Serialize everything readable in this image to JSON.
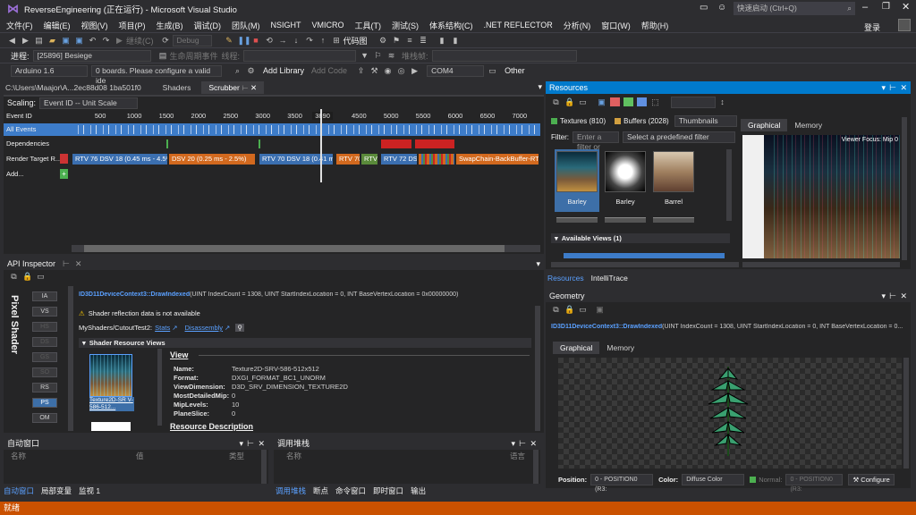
{
  "title": "ReverseEngineering (正在运行) - Microsoft Visual Studio",
  "quick_launch": "快速启动 (Ctrl+Q)",
  "menu": [
    "文件(F)",
    "编辑(E)",
    "视图(V)",
    "项目(P)",
    "生成(B)",
    "调试(D)",
    "团队(M)",
    "NSIGHT",
    "VMICRO",
    "工具(T)",
    "测试(S)",
    "体系结构(C)",
    ".NET REFLECTOR",
    "分析(N)",
    "窗口(W)",
    "帮助(H)"
  ],
  "login": "登录",
  "toolbar1": {
    "continue": "继续(C)",
    "config": "Debug",
    "codemap": "代码图"
  },
  "toolbar2": {
    "process_label": "进程:",
    "process": "[25896] Besiege",
    "lifecycle": "生命周期事件",
    "thread_label": "线程:",
    "stack_label": "堆栈帧:"
  },
  "toolbar3": {
    "board": "Arduino 1.6",
    "boards_msg": "0 boards. Please configure a valid ide",
    "add_library": "Add Library",
    "add_code": "Add Code",
    "port": "COM4",
    "other": "Other"
  },
  "scrubber": {
    "tabs": [
      "C:\\Users\\Maajor\\A...2ec88d08 1ba501f0",
      "Shaders",
      "Scrubber"
    ],
    "scaling_label": "Scaling:",
    "scaling": "Event ID -- Unit Scale",
    "event_id_label": "Event ID",
    "ticks": [
      "500",
      "1000",
      "1500",
      "2000",
      "2500",
      "3000",
      "3500",
      "3890",
      "4500",
      "5000",
      "5500",
      "6000",
      "6500",
      "7000"
    ],
    "rows": [
      "All Events",
      "Dependencies",
      "Render Target R...",
      "Add..."
    ],
    "segments": [
      "RTV 76 DSV 18 (0.45 ms - 4.5%",
      "DSV 20 (0.25 ms - 2.5%)",
      "RTV 70 DSV 18 (0.41 ms",
      "RTV 70",
      "RTV",
      "RTV 72 DS",
      "SwapChain-BackBuffer-RTV"
    ]
  },
  "api_inspector": {
    "title": "API Inspector",
    "vertical_label": "Pixel Shader",
    "stages": [
      "IA",
      "VS",
      "HS",
      "DS",
      "GS",
      "SO",
      "RS",
      "PS",
      "OM"
    ],
    "call": "ID3D11DeviceContext3::DrawIndexed",
    "call_args": "(UINT IndexCount = 1308, UINT StartIndexLocation = 0, INT BaseVertexLocation = 0x00000000)",
    "warning": "Shader reflection data is not available",
    "shader_path": "MyShaders/CutoutTest2:",
    "stats_link": "Stats",
    "disasm_link": "Disassembly",
    "section": "Shader Resource Views",
    "texture_caption": "Texture2D-SR V-586-512...",
    "view_heading": "View",
    "props": [
      {
        "k": "Name:",
        "v": "Texture2D-SRV-586-512x512"
      },
      {
        "k": "Format:",
        "v": "DXGI_FORMAT_BC1_UNORM"
      },
      {
        "k": "ViewDimension:",
        "v": "D3D_SRV_DIMENSION_TEXTURE2D"
      },
      {
        "k": "MostDetailedMip:",
        "v": "0"
      },
      {
        "k": "MipLevels:",
        "v": "10"
      },
      {
        "k": "PlaneSlice:",
        "v": "0"
      }
    ],
    "resource_desc": "Resource Description"
  },
  "autos": {
    "title": "自动窗口",
    "col_name": "名称",
    "col_value": "值",
    "col_type": "类型",
    "tabs": [
      "自动窗口",
      "局部变量",
      "监视 1"
    ]
  },
  "callstack": {
    "title": "调用堆栈",
    "col_name": "名称",
    "col_lang": "语言",
    "tabs": [
      "调用堆栈",
      "断点",
      "命令窗口",
      "即时窗口",
      "输出"
    ]
  },
  "resources": {
    "title": "Resources",
    "textures": "Textures (810)",
    "buffers": "Buffers (2028)",
    "view_mode": "Thumbnails",
    "filter_label": "Filter:",
    "filter_placeholder": "Enter a filter or",
    "predefined": "Select a predefined filter",
    "thumbs": [
      "Barley",
      "Barley",
      "Barrel"
    ],
    "available_views": "Available Views (1)",
    "tabs": [
      "Graphical",
      "Memory"
    ],
    "viewer_focus": "Viewer Focus: Mip 0",
    "bottom_tabs": [
      "Resources",
      "IntelliTrace"
    ]
  },
  "geometry": {
    "title": "Geometry",
    "call": "ID3D11DeviceContext3::DrawIndexed",
    "call_args": "(UINT IndexCount = 1308, UINT StartIndexLocation = 0, INT BaseVertexLocation = 0...",
    "tabs": [
      "Graphical",
      "Memory"
    ],
    "position_label": "Position:",
    "position": "0 - POSITION0 (R3:",
    "color_label": "Color:",
    "color": "Diffuse Color",
    "normal_label": "Normal:",
    "normal": "0 - POSITION0 (R3:",
    "configure": "Configure"
  },
  "status": "就绪",
  "colors": {
    "accent": "#007acc",
    "status": "#ca5100",
    "all_events": "#3d7cc9",
    "deps": "#cc2222"
  }
}
